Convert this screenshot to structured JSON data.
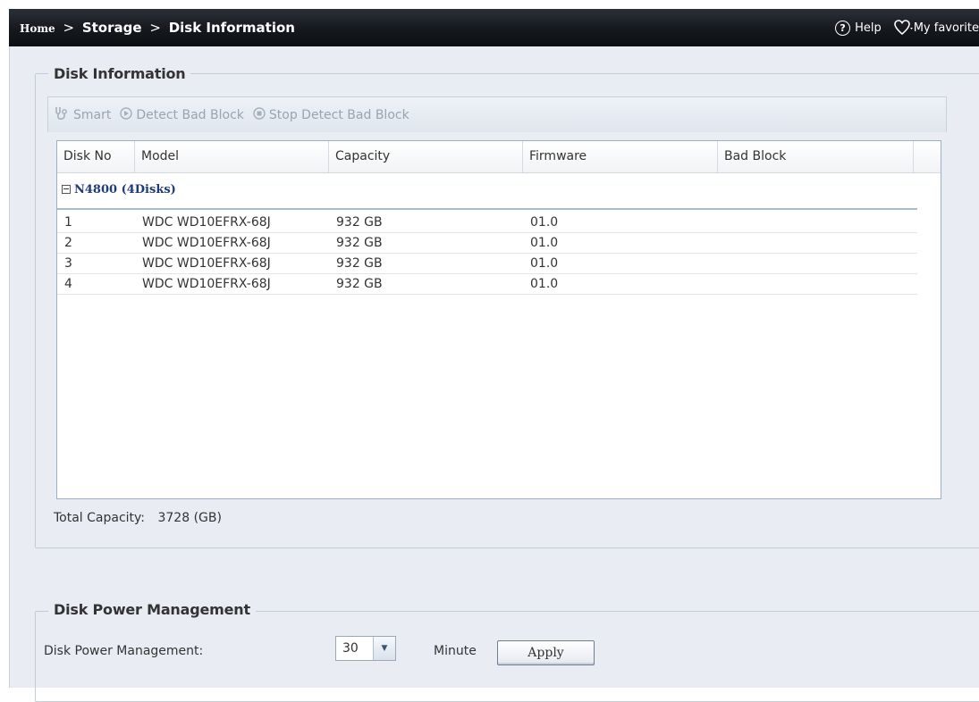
{
  "breadcrumb": {
    "home": "Home",
    "separator": ">",
    "level1": "Storage",
    "level2": "Disk Information"
  },
  "header": {
    "help_label": "Help",
    "favorite_label": "My favorite"
  },
  "disk_info": {
    "legend": "Disk Information",
    "toolbar": {
      "smart_label": "Smart",
      "detect_label": "Detect Bad Block",
      "stop_label": "Stop Detect Bad Block"
    },
    "columns": [
      "Disk No",
      "Model",
      "Capacity",
      "Firmware",
      "Bad Block"
    ],
    "group_label": "N4800 (4Disks)",
    "rows": [
      {
        "disk_no": "1",
        "model": "WDC WD10EFRX-68J",
        "capacity": "932 GB",
        "firmware": "01.0",
        "bad_block": ""
      },
      {
        "disk_no": "2",
        "model": "WDC WD10EFRX-68J",
        "capacity": "932 GB",
        "firmware": "01.0",
        "bad_block": ""
      },
      {
        "disk_no": "3",
        "model": "WDC WD10EFRX-68J",
        "capacity": "932 GB",
        "firmware": "01.0",
        "bad_block": ""
      },
      {
        "disk_no": "4",
        "model": "WDC WD10EFRX-68J",
        "capacity": "932 GB",
        "firmware": "01.0",
        "bad_block": ""
      }
    ],
    "total_label": "Total Capacity:",
    "total_value": "3728 (GB)"
  },
  "power": {
    "legend": "Disk Power Management",
    "label": "Disk Power Management:",
    "selected_value": "30",
    "unit": "Minute",
    "apply_label": "Apply"
  },
  "colors": {
    "topbar": "#15181d",
    "panel_bg": "#e9edf3",
    "group_text": "#1f3a78"
  }
}
